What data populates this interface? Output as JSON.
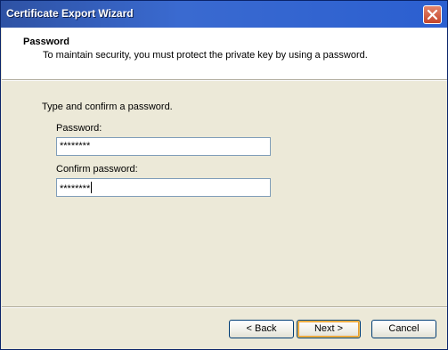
{
  "window": {
    "title": "Certificate Export Wizard"
  },
  "header": {
    "title": "Password",
    "subtitle": "To maintain security, you must protect the private key by using a password."
  },
  "main": {
    "instruction": "Type and confirm a password.",
    "password": {
      "label": "Password:",
      "value": "********"
    },
    "confirm": {
      "label": "Confirm password:",
      "value": "********"
    }
  },
  "buttons": {
    "back": "< Back",
    "next": "Next >",
    "cancel": "Cancel"
  },
  "icons": {
    "close": "close-icon"
  }
}
